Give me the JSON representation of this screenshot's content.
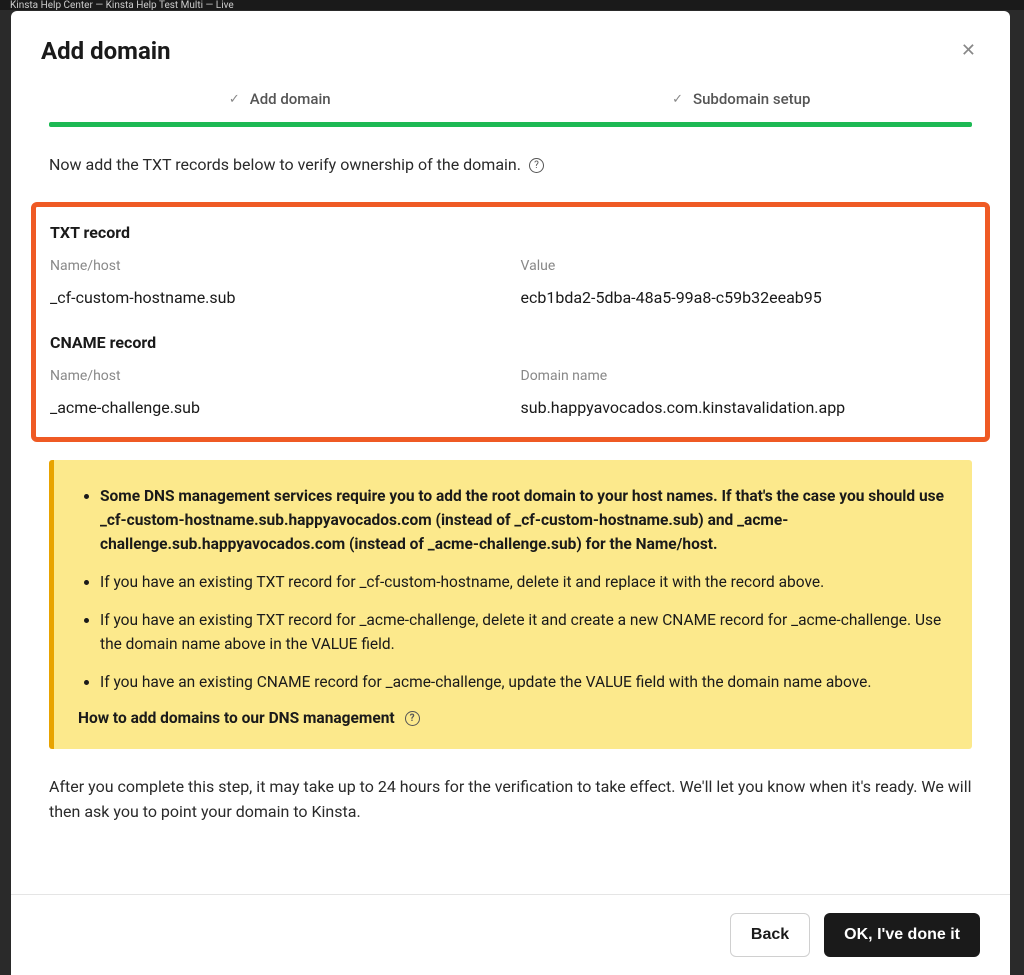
{
  "browser": {
    "tabs": "Kinsta Help Center — Kinsta Help Test Multi — Live"
  },
  "modal": {
    "title": "Add domain"
  },
  "stepper": {
    "step1": "Add domain",
    "step2": "Subdomain setup"
  },
  "instruction": "Now add the TXT records below to verify ownership of the domain.",
  "records": {
    "txt": {
      "title": "TXT record",
      "name_label": "Name/host",
      "name_value": "_cf-custom-hostname.sub",
      "value_label": "Value",
      "value_value": "ecb1bda2-5dba-48a5-99a8-c59b32eeab95"
    },
    "cname": {
      "title": "CNAME record",
      "name_label": "Name/host",
      "name_value": "_acme-challenge.sub",
      "value_label": "Domain name",
      "value_value": "sub.happyavocados.com.kinstavalidation.app"
    }
  },
  "warning": {
    "item1": "Some DNS management services require you to add the root domain to your host names. If that's the case you should use _cf-custom-hostname.sub.happyavocados.com (instead of _cf-custom-hostname.sub) and _acme-challenge.sub.happyavocados.com (instead of _acme-challenge.sub) for the Name/host.",
    "item2": "If you have an existing TXT record for _cf-custom-hostname, delete it and replace it with the record above.",
    "item3": "If you have an existing TXT record for _acme-challenge, delete it and create a new CNAME record for _acme-challenge. Use the domain name above in the VALUE field.",
    "item4": "If you have an existing CNAME record for _acme-challenge, update the VALUE field with the domain name above.",
    "link": "How to add domains to our DNS management"
  },
  "after": "After you complete this step, it may take up to 24 hours for the verification to take effect. We'll let you know when it's ready. We will then ask you to point your domain to Kinsta.",
  "buttons": {
    "back": "Back",
    "done": "OK, I've done it"
  }
}
